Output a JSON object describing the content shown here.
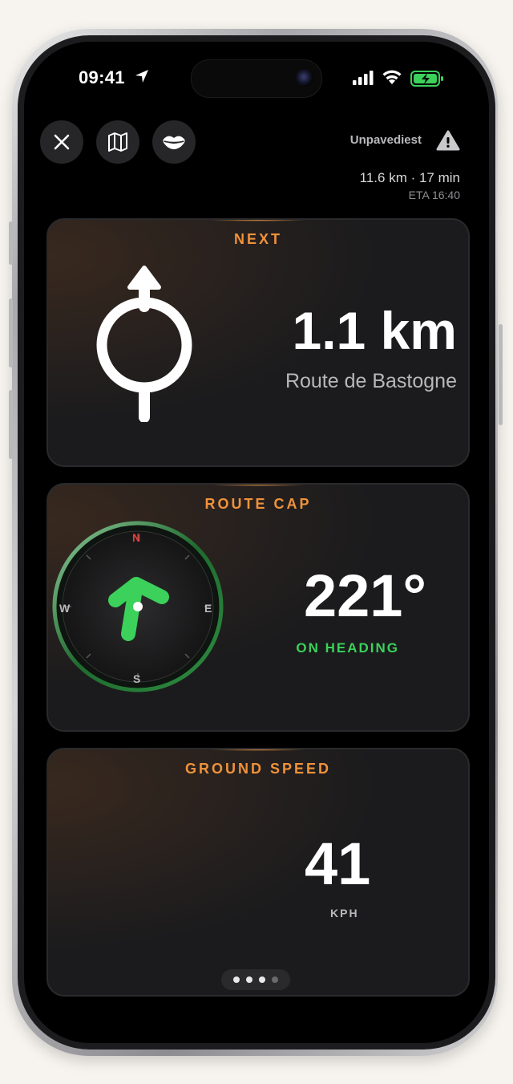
{
  "status_bar": {
    "time": "09:41"
  },
  "header": {
    "map_mode_label": "Unpavediest",
    "trip_summary": "11.6 km · 17 min",
    "eta": "ETA 16:40",
    "buttons": [
      "close-icon",
      "map-icon",
      "lips-icon"
    ]
  },
  "cards": {
    "next": {
      "title": "NEXT",
      "distance": "1.1 km",
      "road": "Route de Bastogne",
      "icon": "roundabout-straight-icon"
    },
    "route_cap": {
      "title": "ROUTE CAP",
      "heading": "221°",
      "status": "ON HEADING",
      "compass": {
        "n": "N",
        "e": "E",
        "s": "S",
        "w": "W"
      },
      "status_color": "#3bd15a"
    },
    "ground_speed": {
      "title": "GROUND SPEED",
      "value": "41",
      "unit": "KPH"
    }
  },
  "pager": {
    "pages": 4,
    "active": 1
  },
  "colors": {
    "accent": "#f0923b",
    "ok": "#3bd15a",
    "north": "#e0403b"
  }
}
